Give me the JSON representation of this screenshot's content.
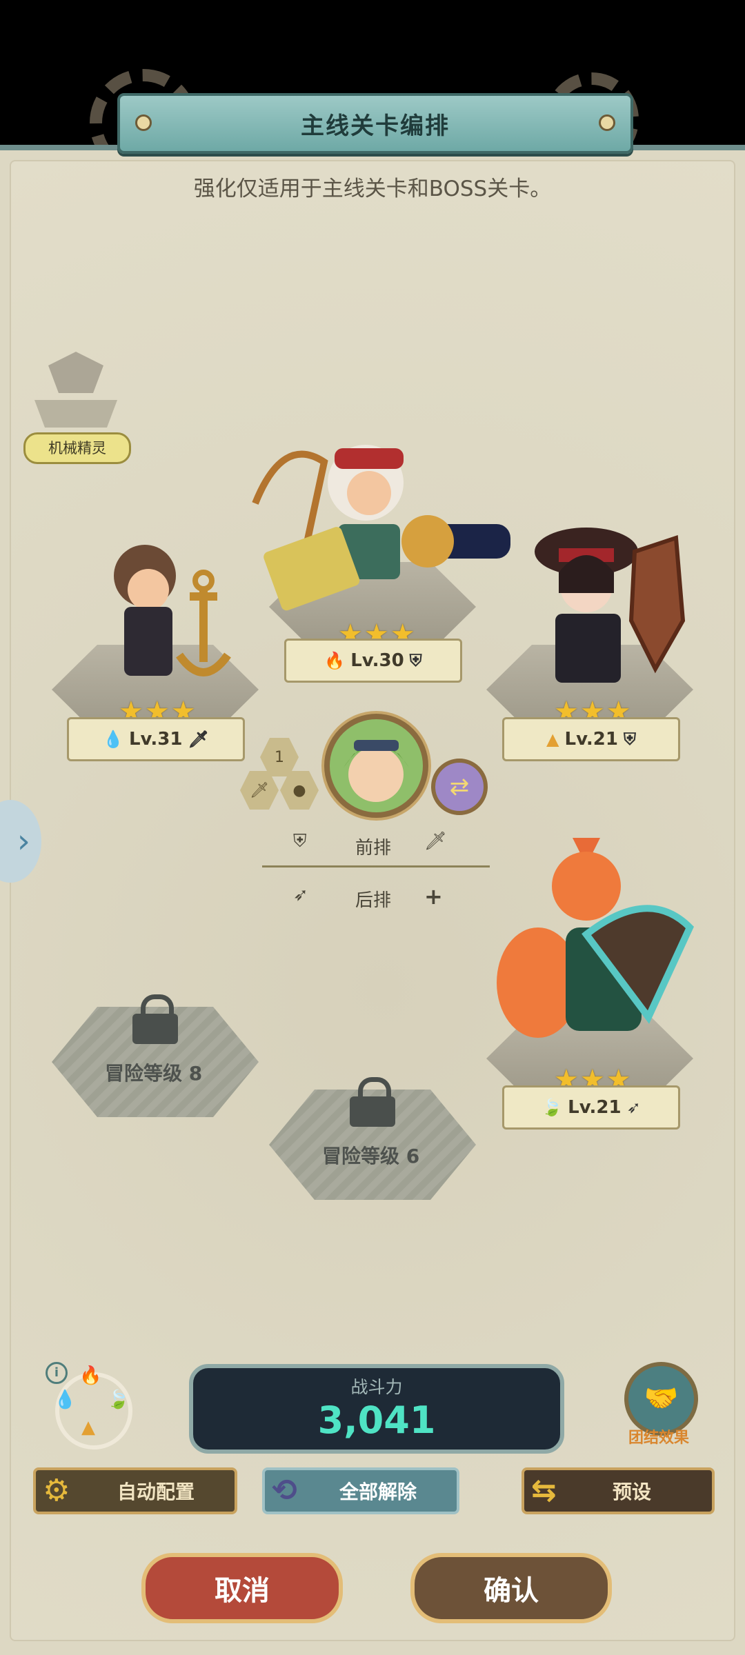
{
  "header": {
    "title": "主线关卡编排",
    "subtitle": "强化仅适用于主线关卡和BOSS关卡。"
  },
  "side_tag": "机械精灵",
  "heroes": [
    {
      "id": "anchor",
      "level": "Lv.31",
      "stars": 3,
      "element": "water",
      "role": "sword"
    },
    {
      "id": "gunner",
      "level": "Lv.30",
      "stars": 3,
      "element": "fire",
      "role": "shield"
    },
    {
      "id": "shield",
      "level": "Lv.21",
      "stars": 3,
      "element": "earth",
      "role": "shield"
    },
    {
      "id": "fox",
      "level": "Lv.21",
      "stars": 3,
      "element": "wind",
      "role": "bow"
    }
  ],
  "locked_slots": [
    {
      "label": "冒险等级 8"
    },
    {
      "label": "冒险等级 6"
    }
  ],
  "leader": {
    "badge": "1"
  },
  "row_legend": {
    "front": "前排",
    "back": "后排"
  },
  "power": {
    "label": "战斗力",
    "value": "3,041"
  },
  "team_effect": "团结效果",
  "buttons": {
    "auto": "自动配置",
    "clear": "全部解除",
    "preset": "预设",
    "cancel": "取消",
    "confirm": "确认"
  },
  "icons": {
    "info": "i",
    "star": "★",
    "side_arrow": "›",
    "swap": "⇄"
  }
}
